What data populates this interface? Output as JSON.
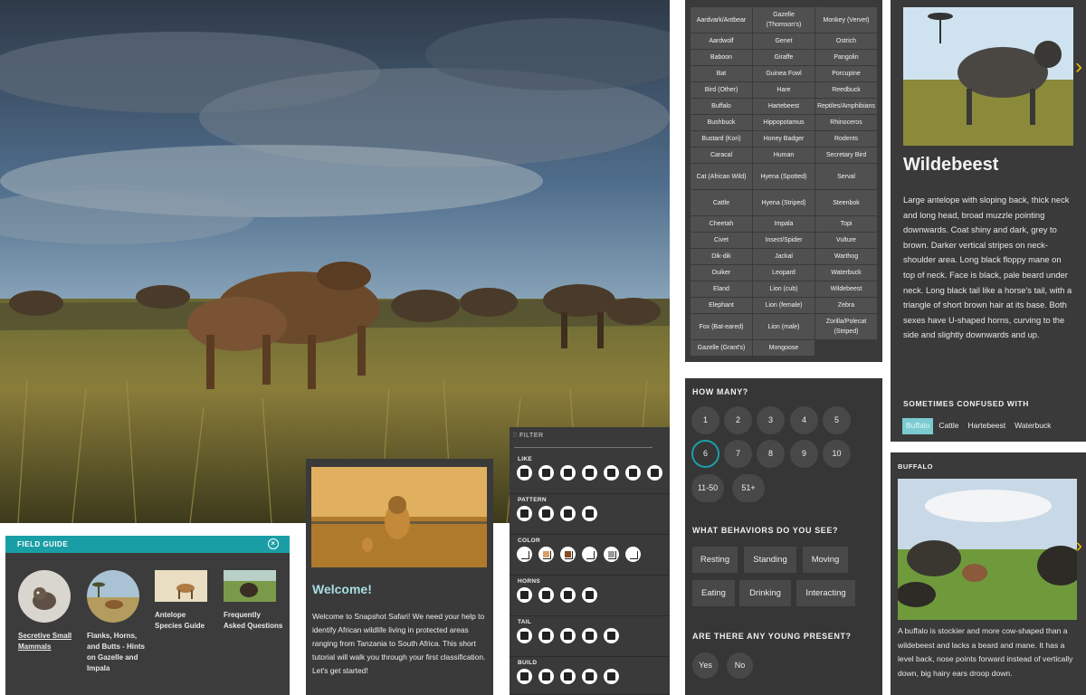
{
  "field_guide": {
    "header": "FIELD GUIDE",
    "items": [
      {
        "label": "Secretive Small Mammals"
      },
      {
        "label": "Flanks, Horns, and Butts - Hints on Gazelle and Impala"
      },
      {
        "label": "Antelope Species Guide"
      },
      {
        "label": "Frequently Asked Questions"
      }
    ]
  },
  "welcome": {
    "title": "Welcome!",
    "text": "Welcome to Snapshot Safari! We need your help to identify African wildlife living in protected areas ranging from Tanzania to South Africa. This short tutorial will walk you through your first classification. Let's get started!"
  },
  "filter": {
    "header": "FILTER",
    "sections": [
      {
        "title": "LIKE",
        "count": 7
      },
      {
        "title": "PATTERN",
        "count": 4
      },
      {
        "title": "COLOR",
        "count": 6,
        "swatches": [
          "#ffffff",
          "#d9a06a",
          "#8a4a1e",
          "#ffffff",
          "#9a9a9a",
          "#ffffff"
        ]
      },
      {
        "title": "HORNS",
        "count": 4
      },
      {
        "title": "TAIL",
        "count": 5
      },
      {
        "title": "BUILD",
        "count": 5
      }
    ]
  },
  "species": [
    "Aardvark/Antbear",
    "Gazelle (Thomson's)",
    "Monkey (Vervet)",
    "Aardwolf",
    "Genet",
    "Ostrich",
    "Baboon",
    "Giraffe",
    "Pangolin",
    "Bat",
    "Guinea Fowl",
    "Porcupine",
    "Bird (Other)",
    "Hare",
    "Reedbuck",
    "Buffalo",
    "Hartebeest",
    "Reptiles/Amphibians",
    "Bushbuck",
    "Hippopotamus",
    "Rhinoceros",
    "Bustard (Kori)",
    "Honey Badger",
    "Rodents",
    "Caracal",
    "Human",
    "Secretary Bird",
    "Cat (African Wild)",
    "Hyena (Spotted)",
    "Serval",
    "Cattle",
    "Hyena (Striped)",
    "Steenbok",
    "Cheetah",
    "Impala",
    "Topi",
    "Civet",
    "Insect/Spider",
    "Vulture",
    "Dik-dik",
    "Jackal",
    "Warthog",
    "Duiker",
    "Leopard",
    "Waterbuck",
    "Eland",
    "Lion (cub)",
    "Wildebeest",
    "Elephant",
    "Lion (female)",
    "Zebra",
    "Fox (Bat-eared)",
    "Lion (male)",
    "Zorilla/Polecat (Striped)",
    "Gazelle (Grant's)",
    "Mongoose"
  ],
  "how_many": {
    "title": "HOW MANY?",
    "options": [
      "1",
      "2",
      "3",
      "4",
      "5",
      "6",
      "7",
      "8",
      "9",
      "10",
      "11-50",
      "51+"
    ],
    "selected": "6",
    "behaviors_title": "WHAT BEHAVIORS DO YOU SEE?",
    "behaviors": [
      "Resting",
      "Standing",
      "Moving",
      "Eating",
      "Drinking",
      "Interacting"
    ],
    "young_title": "ARE THERE ANY YOUNG PRESENT?",
    "young_options": [
      "Yes",
      "No"
    ]
  },
  "wildebeest": {
    "title": "Wildebeest",
    "description": "Large antelope with sloping back, thick neck and long head, broad muzzle pointing downwards. Coat shiny and dark, grey to brown. Darker vertical stripes on neck-shoulder area. Long black floppy mane on top of neck. Face is black, pale beard under neck. Long black tail like a horse's tail, with a triangle of short brown hair at its base. Both sexes have U-shaped horns, curving to the side and slightly downwards and up.",
    "confused_title": "SOMETIMES CONFUSED WITH",
    "confused_with": [
      "Buffalo",
      "Cattle",
      "Hartebeest",
      "Waterbuck"
    ]
  },
  "buffalo": {
    "title": "BUFFALO",
    "description": "A buffalo is stockier and more cow-shaped than a wildebeest and lacks a beard and mane. It has a level back, nose points forward instead of vertically down, big hairy ears droop down."
  },
  "colors": {
    "accent": "#1a9ea6",
    "panel": "#3a3a3a",
    "arrow": "#f2b800"
  }
}
